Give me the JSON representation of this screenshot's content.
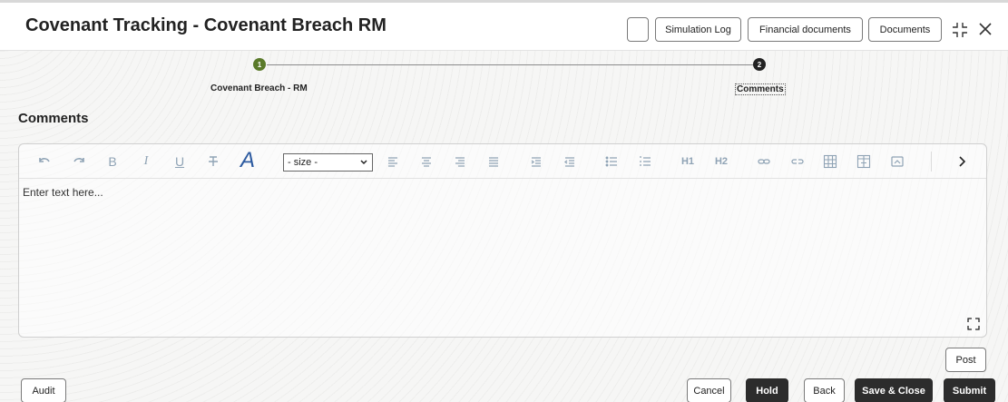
{
  "header": {
    "title": "Covenant Tracking - Covenant Breach RM",
    "buttons": {
      "blank": "",
      "simulation_log": "Simulation Log",
      "financial_documents": "Financial documents",
      "documents": "Documents"
    }
  },
  "stepper": {
    "steps": [
      {
        "number": "1",
        "label": "Covenant Breach - RM",
        "color": "#5a7a2a"
      },
      {
        "number": "2",
        "label": "Comments",
        "color": "#222222"
      }
    ]
  },
  "section": {
    "title": "Comments"
  },
  "editor": {
    "size_select": "- size -",
    "placeholder": "Enter text here...",
    "toolbar_icons": [
      "undo-icon",
      "redo-icon",
      "bold-icon",
      "italic-icon",
      "underline-icon",
      "strikethrough-icon",
      "font-color-icon",
      "align-left-icon",
      "align-center-icon",
      "align-right-icon",
      "justify-icon",
      "indent-icon",
      "outdent-icon",
      "bullet-list-icon",
      "numbered-list-icon",
      "heading-1-icon",
      "heading-2-icon",
      "link-icon",
      "unlink-icon",
      "table-icon",
      "insert-table-icon",
      "image-icon",
      "more-icon"
    ],
    "h1_label": "H1",
    "h2_label": "H2"
  },
  "actions": {
    "post": "Post",
    "audit": "Audit",
    "cancel": "Cancel",
    "hold": "Hold",
    "back": "Back",
    "save_close": "Save & Close",
    "submit": "Submit"
  },
  "colors": {
    "accent_dark": "#2c2c2c",
    "step_active": "#5a7a2a",
    "toolbar_icon": "#8fa3b5"
  }
}
